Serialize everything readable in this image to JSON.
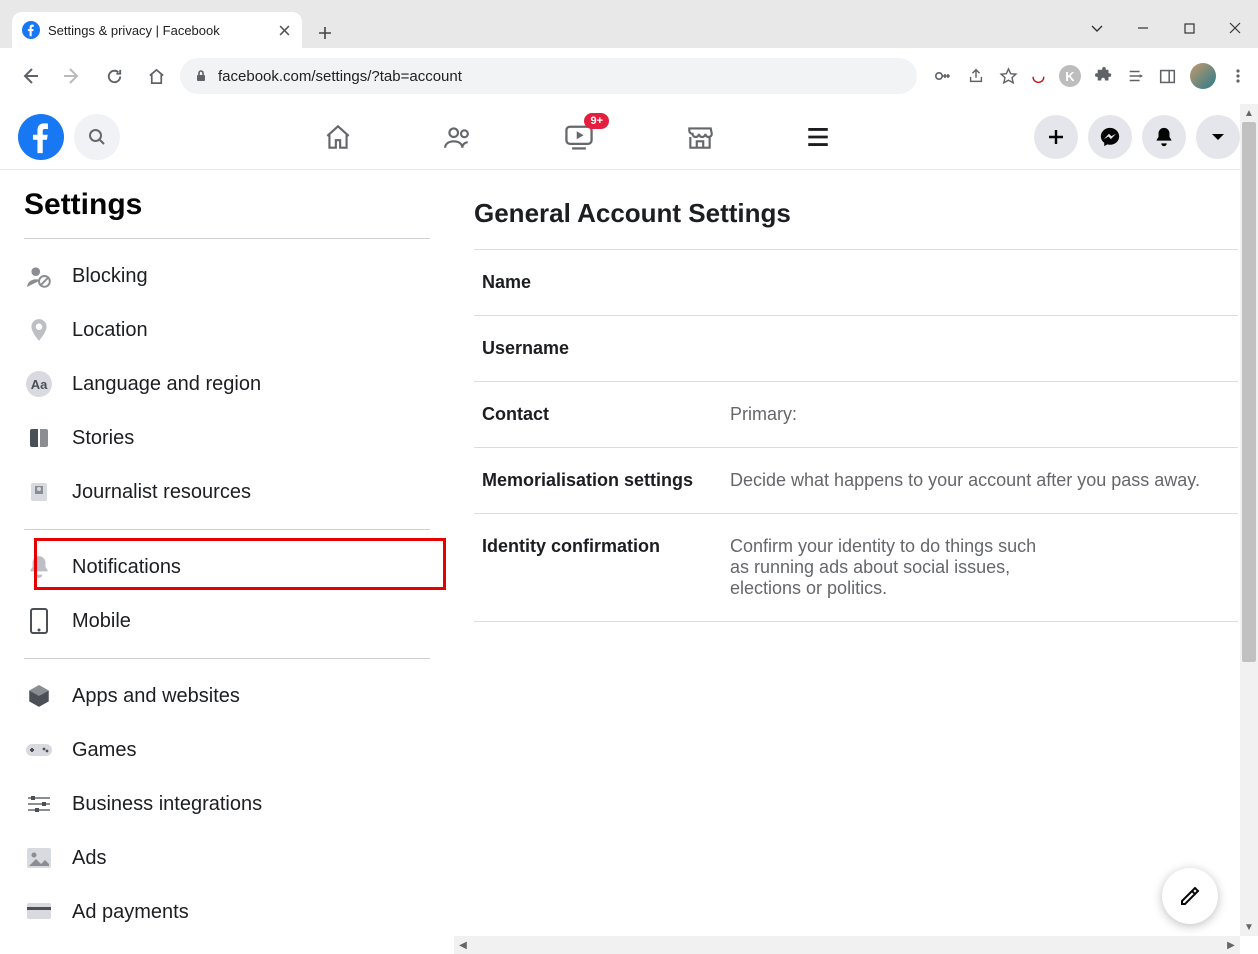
{
  "browser": {
    "tab_title": "Settings & privacy | Facebook",
    "url_display": "facebook.com/settings/?tab=account"
  },
  "fb_nav": {
    "watch_badge": "9+"
  },
  "sidebar": {
    "heading": "Settings",
    "items_a": [
      {
        "label": "Blocking",
        "icon": "person-block"
      },
      {
        "label": "Location",
        "icon": "pin"
      },
      {
        "label": "Language and region",
        "icon": "aa"
      },
      {
        "label": "Stories",
        "icon": "book"
      },
      {
        "label": "Journalist resources",
        "icon": "newspaper"
      }
    ],
    "items_b": [
      {
        "label": "Notifications",
        "icon": "bell",
        "highlighted": true
      },
      {
        "label": "Mobile",
        "icon": "phone"
      }
    ],
    "items_c": [
      {
        "label": "Apps and websites",
        "icon": "cube"
      },
      {
        "label": "Games",
        "icon": "gamepad"
      },
      {
        "label": "Business integrations",
        "icon": "slider"
      },
      {
        "label": "Ads",
        "icon": "image"
      },
      {
        "label": "Ad payments",
        "icon": "card"
      }
    ]
  },
  "main": {
    "heading": "General Account Settings",
    "rows": [
      {
        "label": "Name",
        "value": ""
      },
      {
        "label": "Username",
        "value": ""
      },
      {
        "label": "Contact",
        "value": "Primary:"
      },
      {
        "label": "Memorialisation settings",
        "value": "Decide what happens to your account after you pass away."
      },
      {
        "label": "Identity confirmation",
        "value": "Confirm your identity to do things such as running ads about social issues, elections or politics."
      }
    ]
  }
}
